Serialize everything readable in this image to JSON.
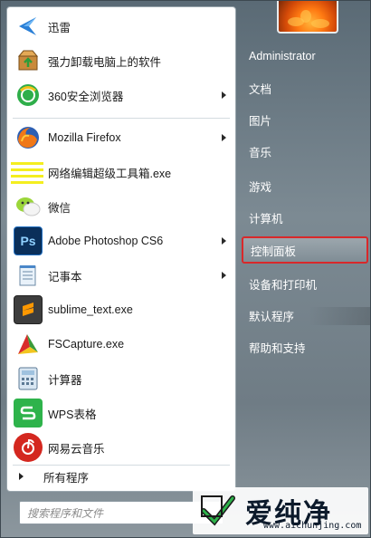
{
  "programs": [
    {
      "label": "迅雷",
      "icon": "thunder-icon",
      "has_arrow": false
    },
    {
      "label": "强力卸载电脑上的软件",
      "icon": "uninstall-box-icon",
      "has_arrow": false
    },
    {
      "label": "360安全浏览器",
      "icon": "browser-360-icon",
      "has_arrow": true
    },
    {
      "label": "Mozilla Firefox",
      "icon": "firefox-icon",
      "has_arrow": true
    },
    {
      "label": "网络编辑超级工具箱.exe",
      "icon": "notepad-stripes-icon",
      "has_arrow": false
    },
    {
      "label": "微信",
      "icon": "wechat-icon",
      "has_arrow": false
    },
    {
      "label": "Adobe Photoshop CS6",
      "icon": "photoshop-icon",
      "has_arrow": true
    },
    {
      "label": "记事本",
      "icon": "notepad-icon",
      "has_arrow": true
    },
    {
      "label": "sublime_text.exe",
      "icon": "sublime-icon",
      "has_arrow": false
    },
    {
      "label": "FSCapture.exe",
      "icon": "fscapture-icon",
      "has_arrow": false
    },
    {
      "label": "计算器",
      "icon": "calculator-icon",
      "has_arrow": false
    },
    {
      "label": "WPS表格",
      "icon": "wps-spreadsheet-icon",
      "has_arrow": false
    },
    {
      "label": "网易云音乐",
      "icon": "netease-music-icon",
      "has_arrow": false
    }
  ],
  "all_programs_label": "所有程序",
  "search": {
    "placeholder": "搜索程序和文件"
  },
  "right": {
    "user": "Administrator",
    "items": [
      "文档",
      "图片",
      "音乐",
      "游戏",
      "计算机",
      "控制面板",
      "设备和打印机",
      "默认程序",
      "帮助和支持"
    ],
    "highlighted": "控制面板"
  },
  "watermark": {
    "text": "爱纯净",
    "url": "www.aichunjing.com"
  }
}
